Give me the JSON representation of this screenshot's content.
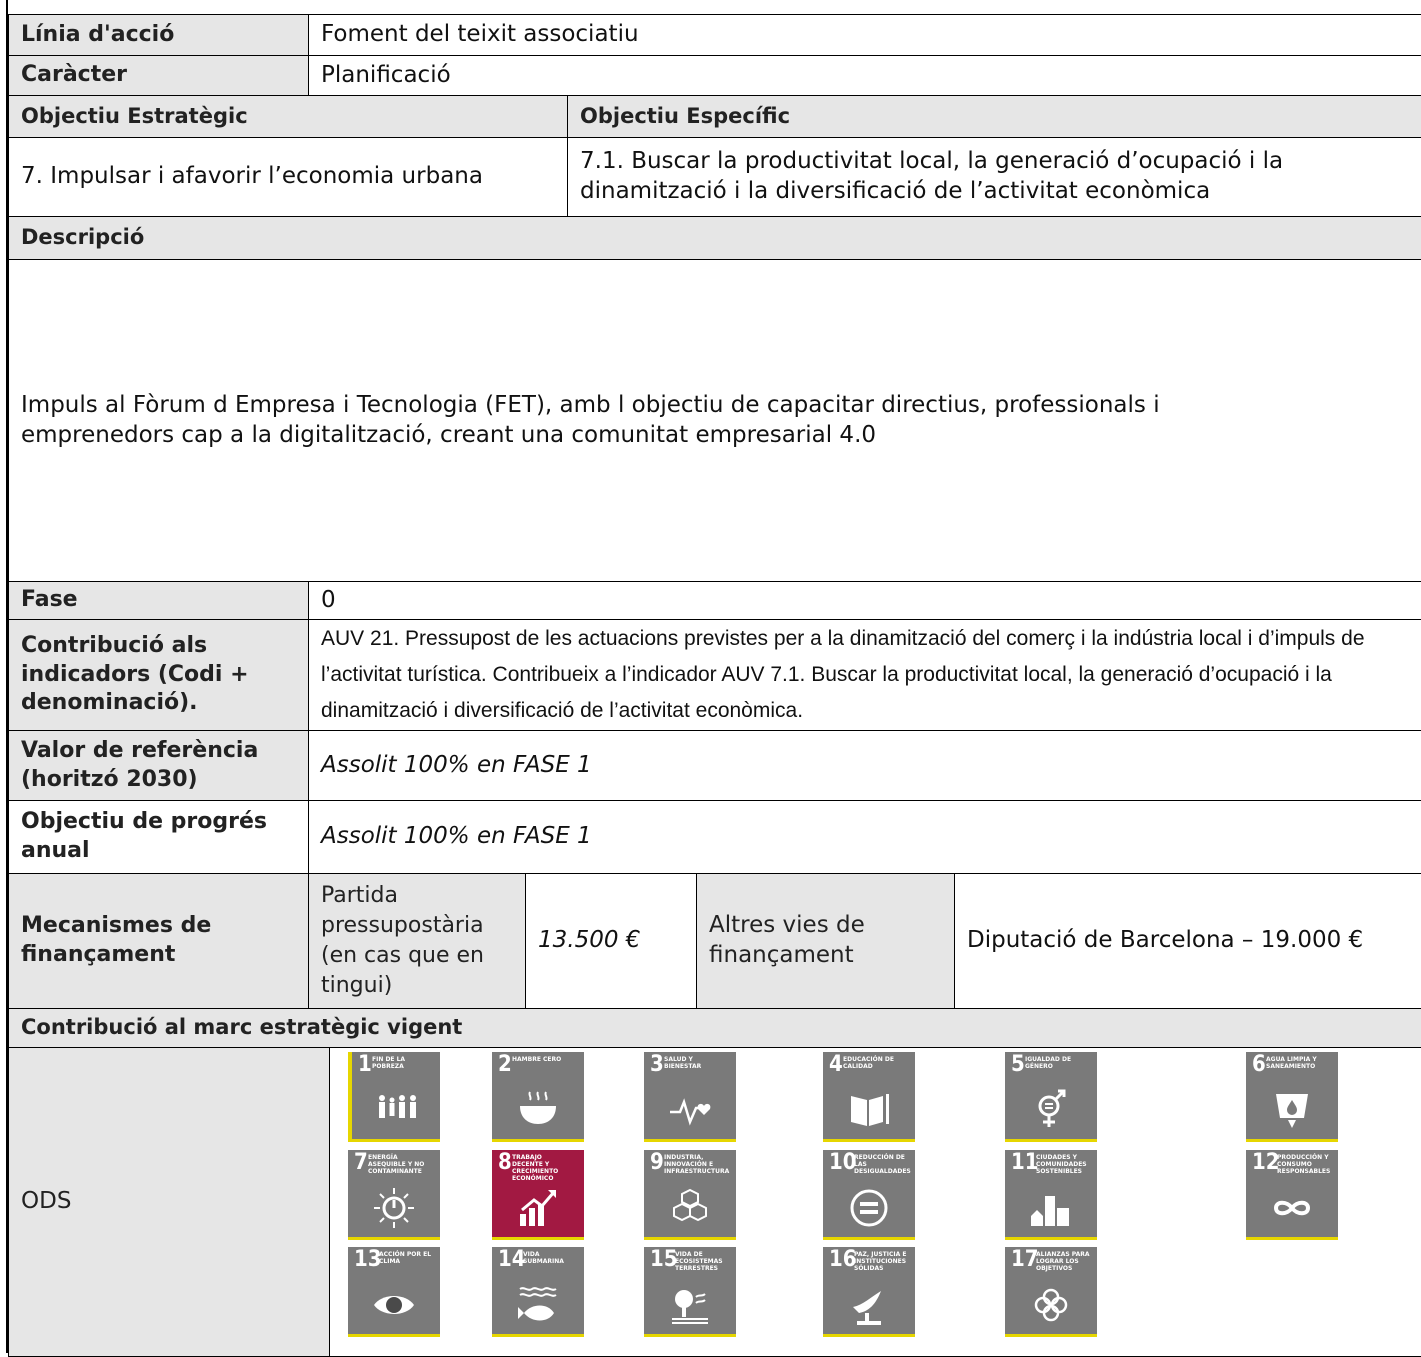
{
  "rows": {
    "linia_label": "Línia d'acció",
    "linia_value": "Foment del teixit associatiu",
    "caracter_label": "Caràcter",
    "caracter_value": "Planificació",
    "obj_estrategic_label": "Objectiu Estratègic",
    "obj_especific_label": "Objectiu Específic",
    "obj_estrategic_value": "7. Impulsar i afavorir l’economia urbana",
    "obj_especific_value": "7.1. Buscar la productivitat local, la generació d’ocupació i la dinamització i la diversificació de l’activitat econòmica",
    "descripcio_label": "Descripció",
    "descripcio_value": "Impuls al Fòrum d Empresa i Tecnologia (FET), amb l objectiu de capacitar directius, professionals i emprenedors cap a la digitalització, creant una comunitat empresarial 4.0",
    "fase_label": "Fase",
    "fase_value": "0",
    "contribucio_label": "Contribució als indicadors (Codi + denominació).",
    "contribucio_value": "AUV 21. Pressupost de les actuacions previstes per a la dinamització del comerç i la indústria local i d’impuls de l’activitat turística. Contribueix a l’indicador AUV 7.1. Buscar la productivitat local, la generació d’ocupació i la dinamització i diversificació de l’activitat econòmica.",
    "valor_label": "Valor de referència (horitzó 2030)",
    "valor_value": "Assolit 100% en FASE 1",
    "progres_label": "Objectiu de progrés anual",
    "progres_value": "Assolit 100% en FASE 1",
    "mecanismes_label": "Mecanismes de finançament",
    "partida_label": "Partida pressupostària (en cas que en tingui)",
    "partida_value": "13.500 €",
    "altres_label": "Altres vies de finançament",
    "altres_value": "Diputació de Barcelona – 19.000 €",
    "marc_label": "Contribució al marc estratègic vigent",
    "ods_label": "ODS"
  },
  "sdgs": [
    {
      "n": "1",
      "t": "Fin de la pobreza",
      "icon": "people-icon"
    },
    {
      "n": "2",
      "t": "Hambre cero",
      "icon": "bowl-icon"
    },
    {
      "n": "3",
      "t": "Salud y bienestar",
      "icon": "heartbeat-icon"
    },
    {
      "n": "4",
      "t": "Educación de calidad",
      "icon": "book-icon"
    },
    {
      "n": "5",
      "t": "Igualdad de género",
      "icon": "gender-icon"
    },
    {
      "n": "6",
      "t": "Agua limpia y saneamiento",
      "icon": "water-icon"
    },
    {
      "n": "7",
      "t": "Energía asequible y no contaminante",
      "icon": "sun-power-icon"
    },
    {
      "n": "8",
      "t": "Trabajo decente y crecimiento económico",
      "icon": "growth-chart-icon",
      "highlighted": true
    },
    {
      "n": "9",
      "t": "Industria, innovación e infraestructura",
      "icon": "cubes-icon"
    },
    {
      "n": "10",
      "t": "Reducción de las desigualdades",
      "icon": "equal-icon"
    },
    {
      "n": "11",
      "t": "Ciudades y comunidades sostenibles",
      "icon": "city-icon"
    },
    {
      "n": "12",
      "t": "Producción y consumo responsables",
      "icon": "infinity-icon"
    },
    {
      "n": "13",
      "t": "Acción por el clima",
      "icon": "eye-globe-icon"
    },
    {
      "n": "14",
      "t": "Vida submarina",
      "icon": "fish-icon"
    },
    {
      "n": "15",
      "t": "Vida de ecosistemas terrestres",
      "icon": "tree-icon"
    },
    {
      "n": "16",
      "t": "Paz, justicia e instituciones sólidas",
      "icon": "dove-icon"
    },
    {
      "n": "17",
      "t": "Alianzas para lograr los objetivos",
      "icon": "flower-icon"
    }
  ],
  "colors": {
    "label_bg": "#e6e6e6",
    "sdg_gray": "#7a7a7a",
    "sdg8": "#a21942",
    "accent": "#e6d600"
  }
}
